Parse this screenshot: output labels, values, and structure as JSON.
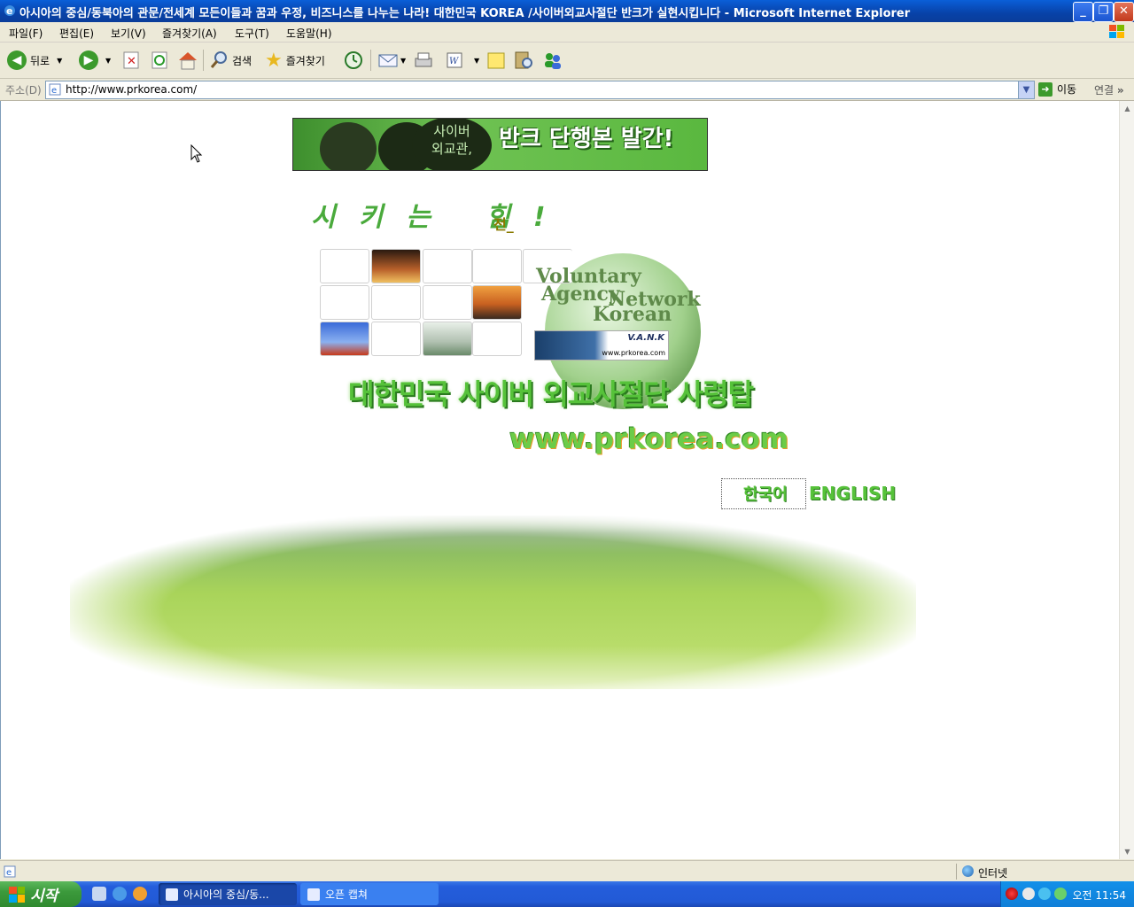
{
  "window": {
    "title": "아시아의 중심/동북아의 관문/전세계 모든이들과 꿈과 우정, 비즈니스를 나누는 나라! 대한민국 KOREA /사이버외교사절단 반크가 실현시킵니다 - Microsoft Internet Explorer",
    "minimize": "_",
    "maximize": "❐",
    "close": "✕"
  },
  "menu": {
    "items": [
      "파일(F)",
      "편집(E)",
      "보기(V)",
      "즐겨찾기(A)",
      "도구(T)",
      "도움말(H)"
    ]
  },
  "toolbar": {
    "back_label": "뒤로",
    "search_label": "검색",
    "favorites_label": "즐겨찾기"
  },
  "address": {
    "label": "주소(D)",
    "url": "http://www.prkorea.com/",
    "go_label": "이동",
    "links_label": "연결"
  },
  "page": {
    "banner_book_text": "사이버\n외교관,",
    "banner_text": "반크 단행본 발간!",
    "slogan": "시키는 힘!",
    "slogan_suffix": "전_",
    "logo_lines": [
      "Voluntary",
      "Agency",
      "Network",
      "Korean"
    ],
    "badge_text": "V.A.N.K",
    "badge_url": "www.prkorea.com",
    "headline": "대한민국 사이버 외교사절단 사령탑",
    "site_url": "www.prkorea.com",
    "lang_korean": "한국어",
    "lang_english": "ENGLISH"
  },
  "status": {
    "zone": "인터넷"
  },
  "taskbar": {
    "start_label": "시작",
    "task1": "아시아의 중심/동...",
    "task2": "오픈 캡쳐",
    "clock": "오전 11:54"
  },
  "colors": {
    "title_bar": "#0842a8",
    "accent_green": "#56c23a",
    "taskbar_blue": "#245ddb"
  }
}
